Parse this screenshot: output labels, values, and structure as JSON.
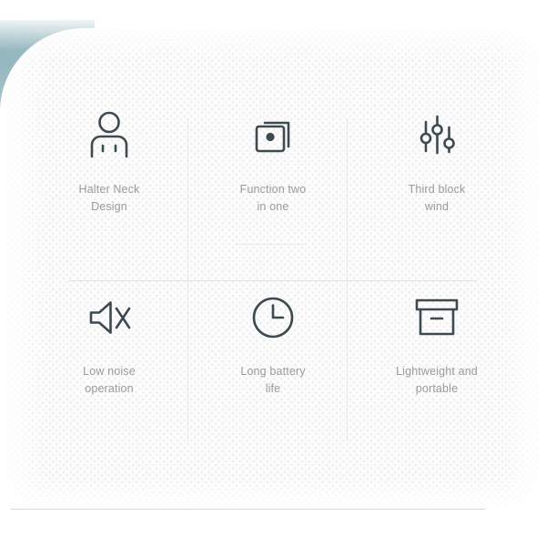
{
  "panel": {
    "background_color": "#fcfcfc",
    "dot_color": "#f0eded",
    "corner_accent_color": "#8fb3bb",
    "bottom_rule_color": "#cfdcdc",
    "divider_color": "#e6e6e6",
    "icon_color": "#3d4a4f",
    "caption_color": "#9a9a9a"
  },
  "features": [
    {
      "icon": "person-halter-neck-icon",
      "caption": "Halter Neck\nDesign"
    },
    {
      "icon": "two-squares-overlap-icon",
      "caption": "Function two\nin one"
    },
    {
      "icon": "equalizer-sliders-icon",
      "caption": "Third block\nwind"
    },
    {
      "icon": "speaker-mute-icon",
      "caption": "Low noise\noperation"
    },
    {
      "icon": "clock-icon",
      "caption": "Long battery\nlife"
    },
    {
      "icon": "box-portable-icon",
      "caption": "Lightweight and\nportable"
    }
  ]
}
